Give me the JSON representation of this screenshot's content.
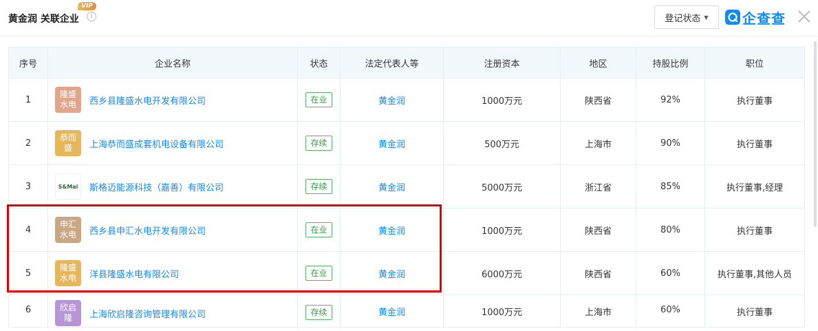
{
  "header": {
    "title": "黄金润 关联企业",
    "vip_badge": "VIP",
    "info_icon": "info-icon",
    "filter_label": "登记状态",
    "logo_text": "企查查",
    "brand_color": "#128bed"
  },
  "table": {
    "columns": [
      "序号",
      "企业名称",
      "状态",
      "法定代表人等",
      "注册资本",
      "地区",
      "持股比例",
      "职位"
    ],
    "rows": [
      {
        "no": "1",
        "logo_text": "隆盛水电",
        "logo_color": "#e0a58a",
        "name": "西乡县隆盛水电开发有限公司",
        "status": "在业",
        "rep": "黄金润",
        "capital": "1000万元",
        "region": "陕西省",
        "share": "92%",
        "position": "执行董事"
      },
      {
        "no": "2",
        "logo_text": "恭而盛",
        "logo_color": "#e8b65a",
        "name": "上海恭而盛成套机电设备有限公司",
        "status": "存续",
        "rep": "黄金润",
        "capital": "500万元",
        "region": "上海市",
        "share": "90%",
        "position": "执行董事"
      },
      {
        "no": "3",
        "logo_text": "S&Mai",
        "logo_color": "#ffffff",
        "name": "斯格迈能源科技（嘉善）有限公司",
        "status": "存续",
        "rep": "黄金润",
        "capital": "5000万元",
        "region": "浙江省",
        "share": "85%",
        "position": "执行董事,经理"
      },
      {
        "no": "4",
        "logo_text": "申汇水电",
        "logo_color": "#c9a784",
        "name": "西乡县申汇水电开发有限公司",
        "status": "在业",
        "rep": "黄金润",
        "capital": "1000万元",
        "region": "陕西省",
        "share": "80%",
        "position": "执行董事"
      },
      {
        "no": "5",
        "logo_text": "隆盛水电",
        "logo_color": "#e8b65a",
        "name": "洋县隆盛水电有限公司",
        "status": "在业",
        "rep": "黄金润",
        "capital": "6000万元",
        "region": "陕西省",
        "share": "60%",
        "position": "执行董事,其他人员"
      },
      {
        "no": "6",
        "logo_text": "欣启隆",
        "logo_color": "#b895d6",
        "name": "上海欣启隆咨询管理有限公司",
        "status": "存续",
        "rep": "黄金润",
        "capital": "1000万元",
        "region": "上海市",
        "share": "60%",
        "position": "执行董事"
      }
    ]
  },
  "highlight": {
    "rows": [
      "4",
      "5"
    ],
    "color": "#e00000"
  }
}
